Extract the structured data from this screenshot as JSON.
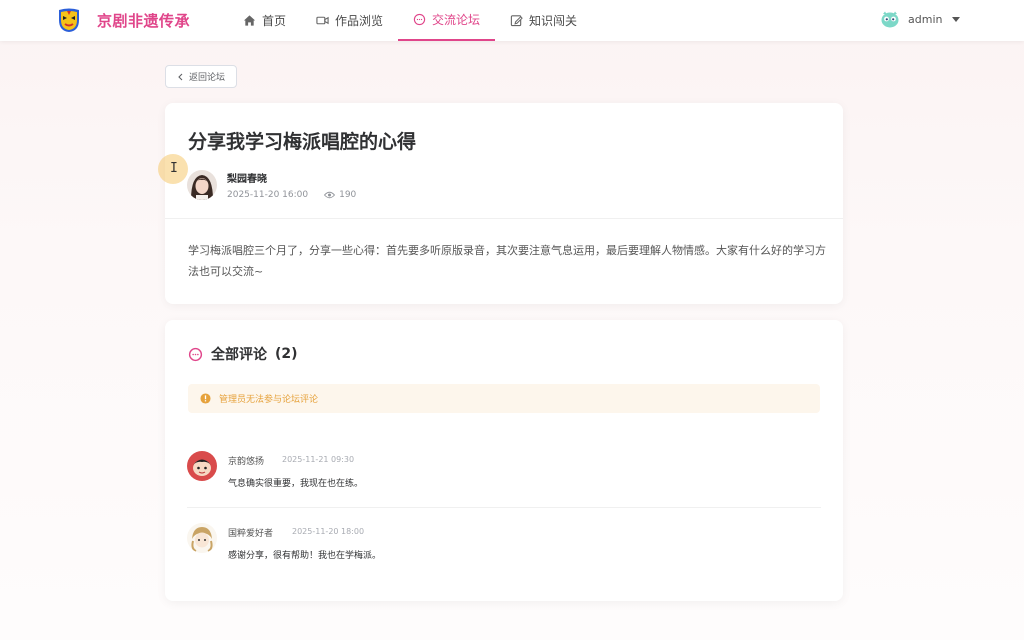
{
  "header": {
    "brand": "京剧非遗传承",
    "nav": [
      {
        "label": "首页",
        "icon": "home-icon"
      },
      {
        "label": "作品浏览",
        "icon": "video-icon"
      },
      {
        "label": "交流论坛",
        "icon": "chat-icon",
        "active": true
      },
      {
        "label": "知识闯关",
        "icon": "edit-icon"
      }
    ],
    "user": "admin"
  },
  "back_button": "返回论坛",
  "post": {
    "title": "分享我学习梅派唱腔的心得",
    "author": "梨园春晓",
    "date": "2025-11-20 16:00",
    "views": "190",
    "content": "学习梅派唱腔三个月了，分享一些心得：首先要多听原版录音，其次要注意气息运用，最后要理解人物情感。大家有什么好的学习方法也可以交流~"
  },
  "comments": {
    "heading": "全部评论",
    "count": "(2)",
    "notice": "管理员无法参与论坛评论",
    "items": [
      {
        "name": "京韵悠扬",
        "time": "2025-11-21 09:30",
        "text": "气息确实很重要，我现在也在练。"
      },
      {
        "name": "国粹爱好者",
        "time": "2025-11-20 18:00",
        "text": "感谢分享，很有帮助！我也在学梅派。"
      }
    ]
  },
  "colors": {
    "accent": "#e0458a",
    "notice_bg": "#fdf6ec",
    "notice_text": "#e6a23c"
  }
}
